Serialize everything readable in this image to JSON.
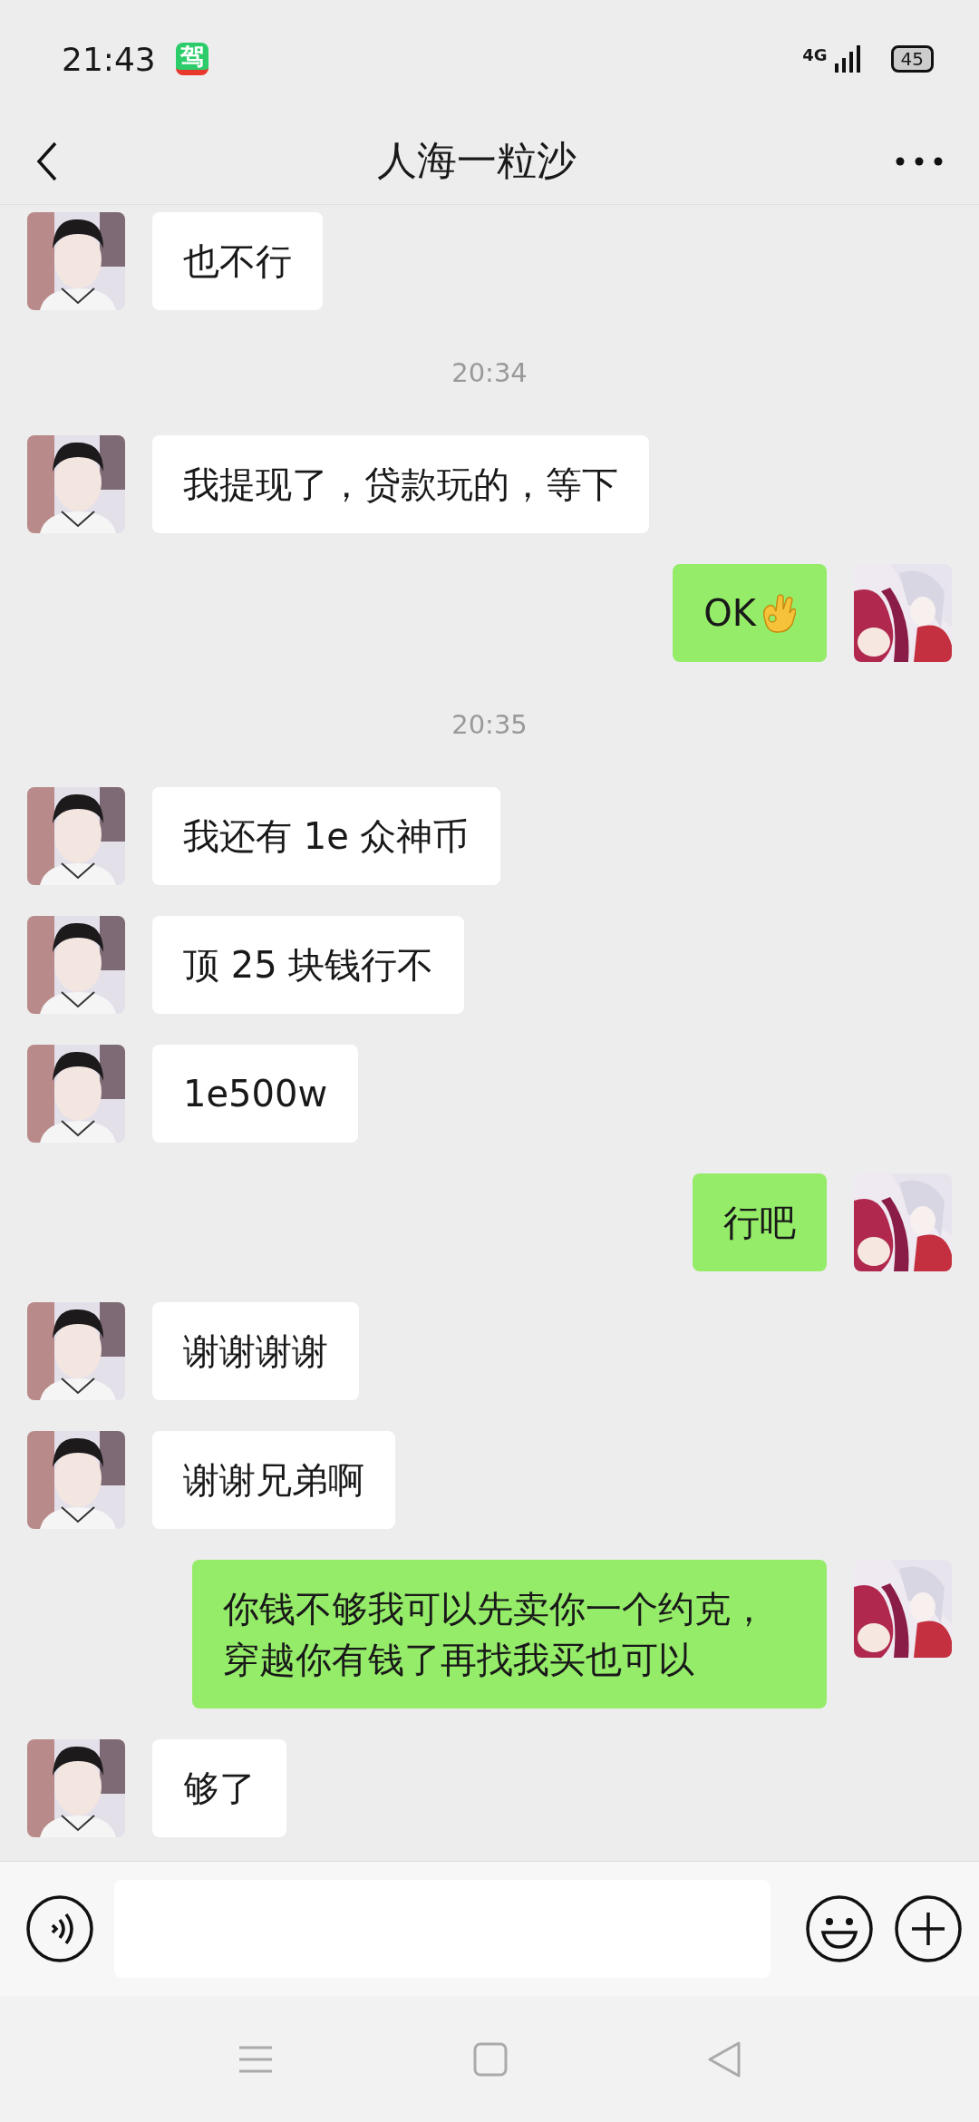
{
  "status_bar": {
    "time": "21:43",
    "app_badge": "驾",
    "network": "4G",
    "battery": "45"
  },
  "header": {
    "title": "人海一粒沙"
  },
  "messages": [
    {
      "kind": "received",
      "text": "也不行"
    },
    {
      "kind": "time",
      "text": "20:34"
    },
    {
      "kind": "received",
      "text": "我提现了，贷款玩的，等下"
    },
    {
      "kind": "sent",
      "text": "OK",
      "emoji_after": true
    },
    {
      "kind": "time",
      "text": "20:35"
    },
    {
      "kind": "received",
      "text": "我还有 1e 众神币"
    },
    {
      "kind": "received",
      "text": "顶 25 块钱行不"
    },
    {
      "kind": "received",
      "text": "1e500w"
    },
    {
      "kind": "sent",
      "text": "行吧"
    },
    {
      "kind": "received",
      "text": "谢谢谢谢"
    },
    {
      "kind": "received",
      "text": "谢谢兄弟啊"
    },
    {
      "kind": "sent",
      "text": "你钱不够我可以先卖你一个约克，穿越你有钱了再找我买也可以"
    },
    {
      "kind": "received",
      "text": "够了"
    }
  ]
}
